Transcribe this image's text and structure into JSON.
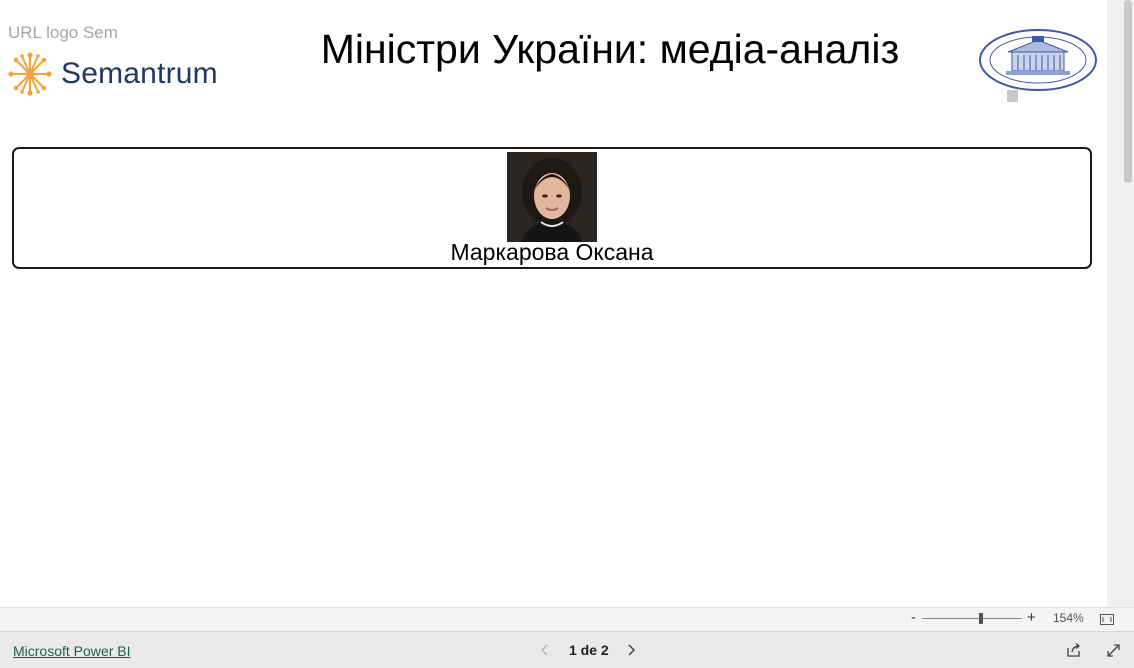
{
  "report": {
    "logo_url_text": "URL logo Sem",
    "brand_name": "Semantrum",
    "title": "Міністри України: медіа-аналіз"
  },
  "minister_card": {
    "name": "Маркарова Оксана"
  },
  "zoom": {
    "minus_label": "-",
    "plus_label": "+",
    "value": "154%",
    "level_fraction": 0.59
  },
  "footer": {
    "powerbi_link": "Microsoft Power BI",
    "page_indicator": "1 de 2"
  },
  "icons": {
    "brand": "sun-burst-logo-icon",
    "seal": "cabinet-of-ministers-seal-icon",
    "prev": "chevron-left-icon",
    "next": "chevron-right-icon",
    "fit": "fit-to-page-icon",
    "share": "share-icon",
    "fullscreen": "expand-icon"
  },
  "colors": {
    "brand_text": "#1f3864",
    "brand_accent": "#f4a33a",
    "link": "#1b5e52",
    "seal": "#3e5aa8"
  }
}
